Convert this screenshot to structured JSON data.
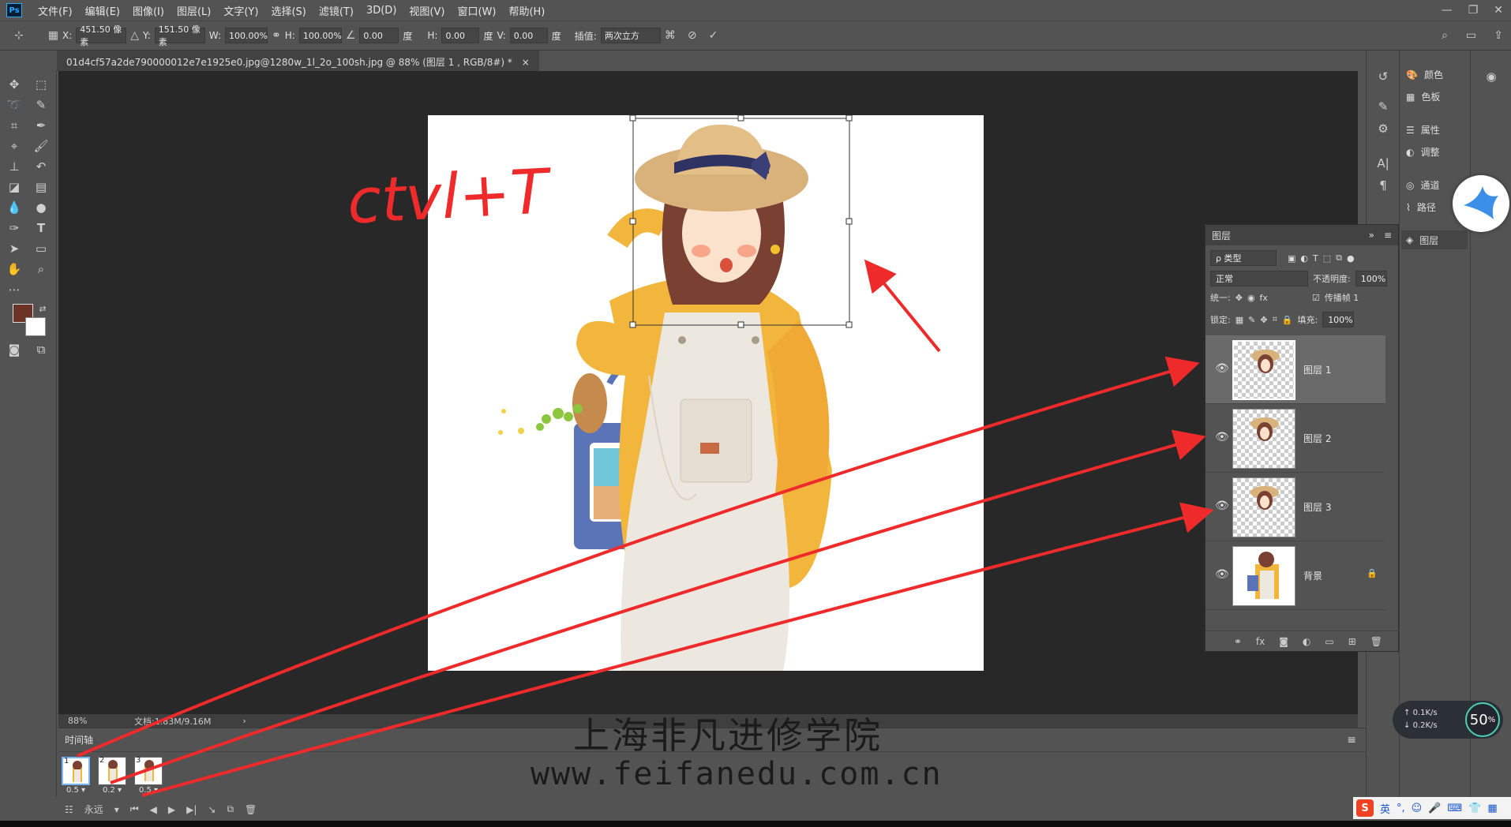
{
  "app": {
    "logo": "Ps"
  },
  "menu": [
    "文件(F)",
    "编辑(E)",
    "图像(I)",
    "图层(L)",
    "文字(Y)",
    "选择(S)",
    "滤镜(T)",
    "3D(D)",
    "视图(V)",
    "窗口(W)",
    "帮助(H)"
  ],
  "options": {
    "x_label": "X:",
    "x_value": "451.50 像素",
    "y_label": "Y:",
    "y_value": "151.50 像素",
    "w_label": "W:",
    "w_value": "100.00%",
    "h_label": "H:",
    "h_value": "100.00%",
    "angle_value": "0.00",
    "angle_unit": "度",
    "hskew_label": "H:",
    "hskew_value": "0.00",
    "hskew_unit": "度",
    "vskew_label": "V:",
    "vskew_value": "0.00",
    "vskew_unit": "度",
    "interp_label": "插值:",
    "interp_value": "两次立方"
  },
  "document": {
    "tab_title": "01d4cf57a2de790000012e7e1925e0.jpg@1280w_1l_2o_100sh.jpg @ 88% (图层 1 , RGB/8#) *",
    "close": "×"
  },
  "status": {
    "zoom": "88%",
    "doc_info": "文档:1.83M/9.16M",
    "arrow": "›"
  },
  "canvas_annotation": "ctvl+T",
  "timeline": {
    "title": "时间轴",
    "frames": [
      {
        "num": "1",
        "delay": "0.5 ▾"
      },
      {
        "num": "2",
        "delay": "0.2 ▾"
      },
      {
        "num": "3",
        "delay": "0.5 ▾"
      }
    ],
    "loop": "永远"
  },
  "layers_panel": {
    "title": "图层",
    "filter": "ρ 类型",
    "blend_mode": "正常",
    "opacity_label": "不透明度:",
    "opacity_value": "100%",
    "unify_label": "统一:",
    "propagate_label": "传播帧 1",
    "lock_label": "锁定:",
    "fill_label": "填充:",
    "fill_value": "100%",
    "layers": [
      {
        "name": "图层 1",
        "selected": true
      },
      {
        "name": "图层 2",
        "selected": false
      },
      {
        "name": "图层 3",
        "selected": false
      },
      {
        "name": "背景",
        "selected": false
      }
    ]
  },
  "dock": {
    "items": [
      {
        "label": "颜色",
        "icon": "palette-icon"
      },
      {
        "label": "色板",
        "icon": "swatches-icon"
      },
      {
        "label": "属性",
        "icon": "properties-icon"
      },
      {
        "label": "调整",
        "icon": "adjustments-icon"
      },
      {
        "label": "通道",
        "icon": "channels-icon"
      },
      {
        "label": "路径",
        "icon": "paths-icon"
      },
      {
        "label": "图层",
        "icon": "layers-icon"
      }
    ]
  },
  "watermark": {
    "cn": "上海非凡进修学院",
    "url": "www.feifanedu.com.cn"
  },
  "network_widget": {
    "up": "0.1",
    "down": "0.2",
    "unit": "K/s",
    "percent": "50",
    "percent_sign": "%"
  },
  "ime": {
    "logo": "S",
    "lang": "英"
  },
  "colors": {
    "foreground": "#6b3326",
    "background": "#ffffff",
    "annotation": "#ee2a2a"
  }
}
